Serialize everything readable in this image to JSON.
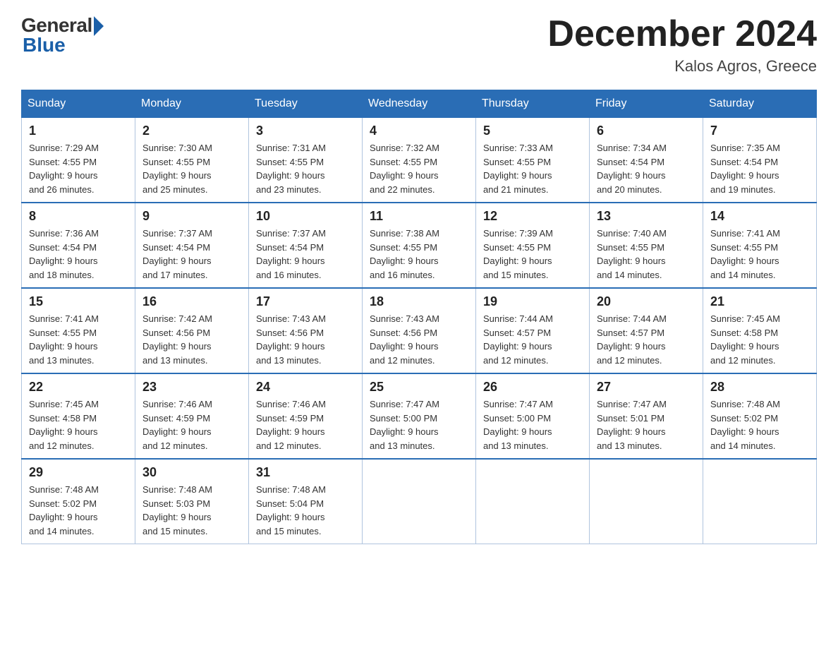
{
  "logo": {
    "general": "General",
    "blue": "Blue"
  },
  "title": {
    "month_year": "December 2024",
    "location": "Kalos Agros, Greece"
  },
  "weekdays": [
    "Sunday",
    "Monday",
    "Tuesday",
    "Wednesday",
    "Thursday",
    "Friday",
    "Saturday"
  ],
  "weeks": [
    [
      {
        "day": "1",
        "sunrise": "7:29 AM",
        "sunset": "4:55 PM",
        "daylight": "9 hours and 26 minutes."
      },
      {
        "day": "2",
        "sunrise": "7:30 AM",
        "sunset": "4:55 PM",
        "daylight": "9 hours and 25 minutes."
      },
      {
        "day": "3",
        "sunrise": "7:31 AM",
        "sunset": "4:55 PM",
        "daylight": "9 hours and 23 minutes."
      },
      {
        "day": "4",
        "sunrise": "7:32 AM",
        "sunset": "4:55 PM",
        "daylight": "9 hours and 22 minutes."
      },
      {
        "day": "5",
        "sunrise": "7:33 AM",
        "sunset": "4:55 PM",
        "daylight": "9 hours and 21 minutes."
      },
      {
        "day": "6",
        "sunrise": "7:34 AM",
        "sunset": "4:54 PM",
        "daylight": "9 hours and 20 minutes."
      },
      {
        "day": "7",
        "sunrise": "7:35 AM",
        "sunset": "4:54 PM",
        "daylight": "9 hours and 19 minutes."
      }
    ],
    [
      {
        "day": "8",
        "sunrise": "7:36 AM",
        "sunset": "4:54 PM",
        "daylight": "9 hours and 18 minutes."
      },
      {
        "day": "9",
        "sunrise": "7:37 AM",
        "sunset": "4:54 PM",
        "daylight": "9 hours and 17 minutes."
      },
      {
        "day": "10",
        "sunrise": "7:37 AM",
        "sunset": "4:54 PM",
        "daylight": "9 hours and 16 minutes."
      },
      {
        "day": "11",
        "sunrise": "7:38 AM",
        "sunset": "4:55 PM",
        "daylight": "9 hours and 16 minutes."
      },
      {
        "day": "12",
        "sunrise": "7:39 AM",
        "sunset": "4:55 PM",
        "daylight": "9 hours and 15 minutes."
      },
      {
        "day": "13",
        "sunrise": "7:40 AM",
        "sunset": "4:55 PM",
        "daylight": "9 hours and 14 minutes."
      },
      {
        "day": "14",
        "sunrise": "7:41 AM",
        "sunset": "4:55 PM",
        "daylight": "9 hours and 14 minutes."
      }
    ],
    [
      {
        "day": "15",
        "sunrise": "7:41 AM",
        "sunset": "4:55 PM",
        "daylight": "9 hours and 13 minutes."
      },
      {
        "day": "16",
        "sunrise": "7:42 AM",
        "sunset": "4:56 PM",
        "daylight": "9 hours and 13 minutes."
      },
      {
        "day": "17",
        "sunrise": "7:43 AM",
        "sunset": "4:56 PM",
        "daylight": "9 hours and 13 minutes."
      },
      {
        "day": "18",
        "sunrise": "7:43 AM",
        "sunset": "4:56 PM",
        "daylight": "9 hours and 12 minutes."
      },
      {
        "day": "19",
        "sunrise": "7:44 AM",
        "sunset": "4:57 PM",
        "daylight": "9 hours and 12 minutes."
      },
      {
        "day": "20",
        "sunrise": "7:44 AM",
        "sunset": "4:57 PM",
        "daylight": "9 hours and 12 minutes."
      },
      {
        "day": "21",
        "sunrise": "7:45 AM",
        "sunset": "4:58 PM",
        "daylight": "9 hours and 12 minutes."
      }
    ],
    [
      {
        "day": "22",
        "sunrise": "7:45 AM",
        "sunset": "4:58 PM",
        "daylight": "9 hours and 12 minutes."
      },
      {
        "day": "23",
        "sunrise": "7:46 AM",
        "sunset": "4:59 PM",
        "daylight": "9 hours and 12 minutes."
      },
      {
        "day": "24",
        "sunrise": "7:46 AM",
        "sunset": "4:59 PM",
        "daylight": "9 hours and 12 minutes."
      },
      {
        "day": "25",
        "sunrise": "7:47 AM",
        "sunset": "5:00 PM",
        "daylight": "9 hours and 13 minutes."
      },
      {
        "day": "26",
        "sunrise": "7:47 AM",
        "sunset": "5:00 PM",
        "daylight": "9 hours and 13 minutes."
      },
      {
        "day": "27",
        "sunrise": "7:47 AM",
        "sunset": "5:01 PM",
        "daylight": "9 hours and 13 minutes."
      },
      {
        "day": "28",
        "sunrise": "7:48 AM",
        "sunset": "5:02 PM",
        "daylight": "9 hours and 14 minutes."
      }
    ],
    [
      {
        "day": "29",
        "sunrise": "7:48 AM",
        "sunset": "5:02 PM",
        "daylight": "9 hours and 14 minutes."
      },
      {
        "day": "30",
        "sunrise": "7:48 AM",
        "sunset": "5:03 PM",
        "daylight": "9 hours and 15 minutes."
      },
      {
        "day": "31",
        "sunrise": "7:48 AM",
        "sunset": "5:04 PM",
        "daylight": "9 hours and 15 minutes."
      },
      null,
      null,
      null,
      null
    ]
  ],
  "labels": {
    "sunrise": "Sunrise:",
    "sunset": "Sunset:",
    "daylight": "Daylight:"
  }
}
